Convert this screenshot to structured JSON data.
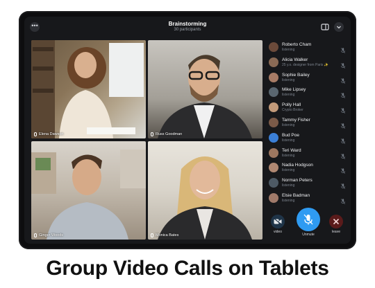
{
  "header": {
    "title": "Brainstorming",
    "subtitle": "30 participants"
  },
  "tiles": [
    {
      "name": "Elena Dawson"
    },
    {
      "name": "Russ Goodman"
    },
    {
      "name": "Ginger Woods"
    },
    {
      "name": "Monica Bates"
    }
  ],
  "participants": [
    {
      "name": "Roberto Cham",
      "status": "listening",
      "color": "#6b4a3a"
    },
    {
      "name": "Alicia Walker",
      "status": "25 y.o. designer from Paris ✨",
      "color": "#8a6a55"
    },
    {
      "name": "Sophie Bailey",
      "status": "listening",
      "color": "#a87c66"
    },
    {
      "name": "Mike Lipsey",
      "status": "listening",
      "color": "#5a6670"
    },
    {
      "name": "Polly Hall",
      "status": "Crypto Broker",
      "color": "#c29a7a"
    },
    {
      "name": "Tammy Fisher",
      "status": "listening",
      "color": "#7a5a48"
    },
    {
      "name": "Bud Poe",
      "status": "listening",
      "color": "#3b7fd6"
    },
    {
      "name": "Teri Ward",
      "status": "listening",
      "color": "#9d7760"
    },
    {
      "name": "Nadia Hodgson",
      "status": "listening",
      "color": "#b08872"
    },
    {
      "name": "Norman Peters",
      "status": "listening",
      "color": "#4e5a65"
    },
    {
      "name": "Elsie Badman",
      "status": "listening",
      "color": "#a07a6a"
    }
  ],
  "controls": {
    "video_label": "video",
    "unmute_label": "Unmute",
    "leave_label": "leave"
  },
  "caption": "Group Video Calls on Tablets",
  "colors": {
    "accent": "#2f9bf2",
    "leave": "#5a1b1b",
    "background": "#17181b"
  }
}
